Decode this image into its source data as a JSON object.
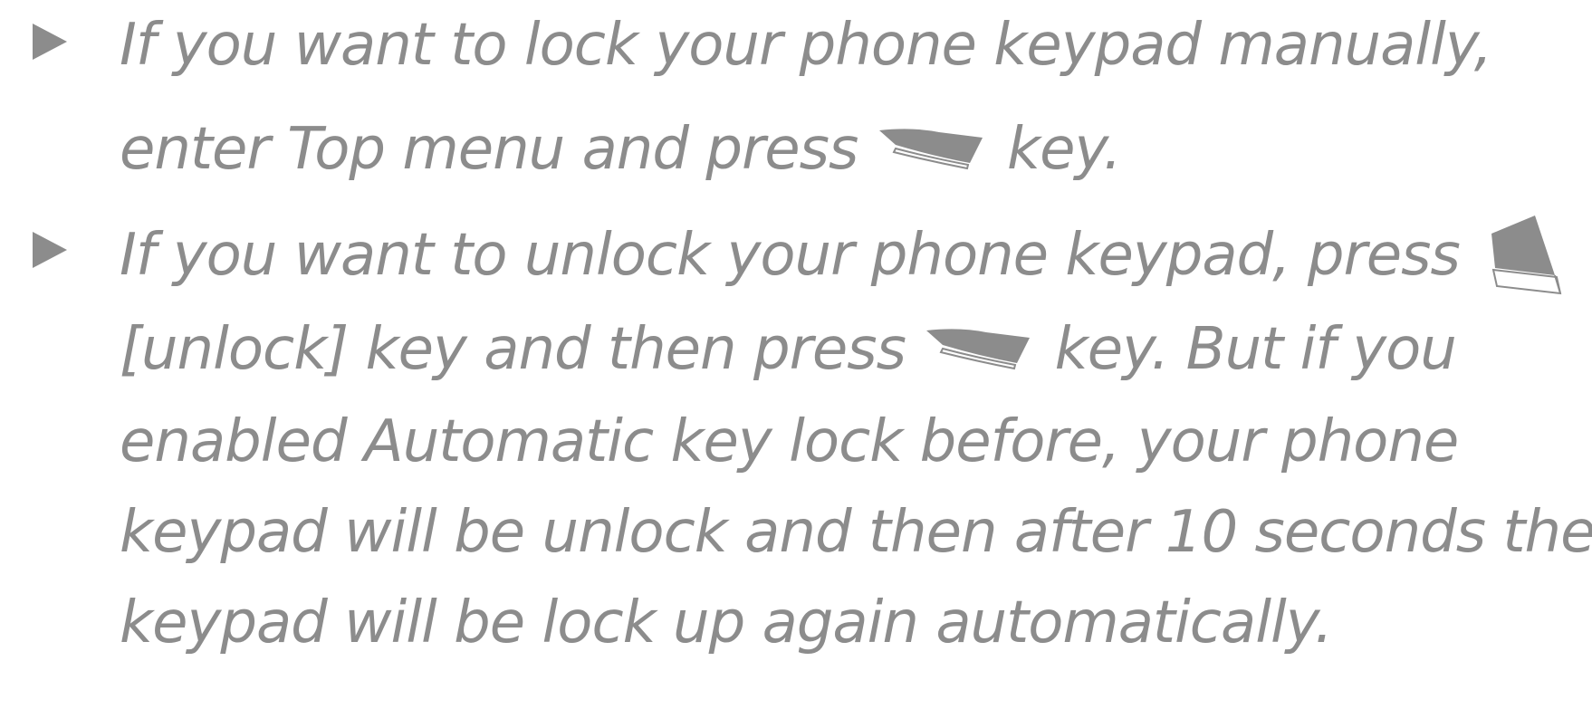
{
  "bullets": [
    {
      "line1": "If you want to lock your phone keypad manually,",
      "line2_before": "enter Top menu and press",
      "line2_after": "key.",
      "key_icon": "left-soft-key-icon"
    },
    {
      "line1_before": "If you want to unlock your phone keypad, press",
      "line1_icon": "right-soft-key-icon",
      "line2_before": "[unlock] key and then press",
      "line2_icon": "left-soft-key-icon",
      "line2_after": "key. But if you",
      "line3": "enabled Automatic key lock before, your phone",
      "line4": "keypad will be unlock and then after 10 seconds the",
      "line5": "keypad will be lock up again automatically."
    }
  ],
  "colors": {
    "text": "#8c8c8c",
    "marker": "#8c8c8c"
  }
}
